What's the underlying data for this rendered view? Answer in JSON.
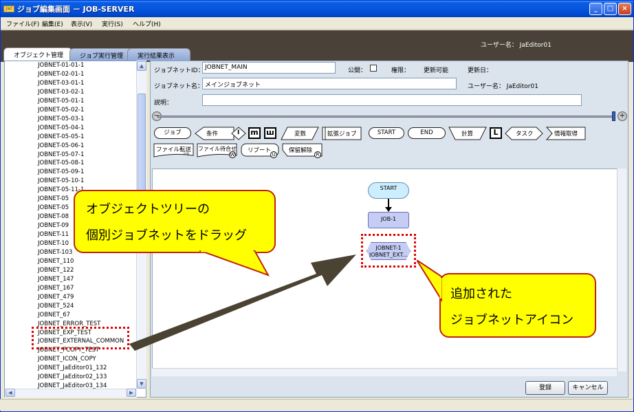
{
  "window": {
    "title": "ジョブ編集画面 － JOB-SERVER",
    "logo": "Jaz",
    "minimize": "_",
    "maximize": "□",
    "close": "×"
  },
  "menu": {
    "items": [
      "ファイル(F)",
      "編集(E)",
      "表示(V)",
      "実行(S)",
      "ヘルプ(H)"
    ]
  },
  "header": {
    "user_label": "ユーザー名： JaEditor01"
  },
  "tabs": [
    {
      "label": "オブジェクト管理",
      "active": true
    },
    {
      "label": "ジョブ実行管理",
      "active": false
    },
    {
      "label": "実行結果表示",
      "active": false
    }
  ],
  "tree": {
    "items": [
      "JOBNET-01-01-1",
      "JOBNET-02-01-1",
      "JOBNET-03-01-1",
      "JOBNET-03-02-1",
      "JOBNET-05-01-1",
      "JOBNET-05-02-1",
      "JOBNET-05-03-1",
      "JOBNET-05-04-1",
      "JOBNET-05-05-1",
      "JOBNET-05-06-1",
      "JOBNET-05-07-1",
      "JOBNET-05-08-1",
      "JOBNET-05-09-1",
      "JOBNET-05-10-1",
      "JOBNET-05-11-1",
      "JOBNET-05",
      "JOBNET-05",
      "JOBNET-08",
      "JOBNET-09",
      "JOBNET-11",
      "JOBNET-10",
      "JOBNET-103",
      "JOBNET_110",
      "JOBNET_122",
      "JOBNET_147",
      "JOBNET_167",
      "JOBNET_479",
      "JOBNET_524",
      "JOBNET_67",
      "JOBNET_ERROR_TEST",
      "JOBNET_EXP_TEST",
      "JOBNET_EXTERNAL_COMMON",
      "JOBNET_FCOPY_TEST",
      "JOBNET_ICON_COPY",
      "JOBNET_JaEditor01_132",
      "JOBNET_JaEditor02_133",
      "JOBNET_JaEditor03_134"
    ]
  },
  "form": {
    "jobnet_id_label": "ジョブネットID：",
    "jobnet_id_value": "JOBNET_MAIN",
    "public_label": "公開：",
    "permission_label": "権限：",
    "permission_value": "更新可能",
    "update_date_label": "更新日：",
    "jobnet_name_label": "ジョブネット名：",
    "jobnet_name_value": "メインジョブネット",
    "user_label": "ユーザー名： JaEditor01",
    "description_label": "説明：",
    "description_value": ""
  },
  "zoom": {
    "minus": "−",
    "plus": "+"
  },
  "palette": {
    "job": "ジョブ",
    "condition": "条件",
    "par_i": "I",
    "par_m": "m",
    "par_w": "ш",
    "variable": "変数",
    "ext_job": "拡張ジョブ",
    "start": "START",
    "end": "END",
    "calc": "計算",
    "loop": "L",
    "task": "タスク",
    "info": "情報取得",
    "file_transfer": "ファイル転送",
    "file_wait": "ファイル待合せ",
    "reboot": "リブート",
    "hold_release": "保留解除",
    "badge_w": "W",
    "badge_u": "U",
    "badge_r": "R"
  },
  "canvas": {
    "start_node": "START",
    "job_node": "JOB-1",
    "jobnet_node_line1": "JOBNET-1",
    "jobnet_node_line2": "JOBNET_EXT..."
  },
  "buttons": {
    "register": "登録",
    "cancel": "キャンセル"
  },
  "callouts": {
    "drag": {
      "line1": "オブジェクトツリーの",
      "line2": "個別ジョブネットをドラッグ"
    },
    "added": {
      "line1": "追加された",
      "line2": "ジョブネットアイコン"
    }
  },
  "colors": {
    "callout_fill": "#ffff00",
    "callout_border": "#c02010",
    "highlight_dash": "#e00000",
    "arrow": "#4a4232"
  }
}
